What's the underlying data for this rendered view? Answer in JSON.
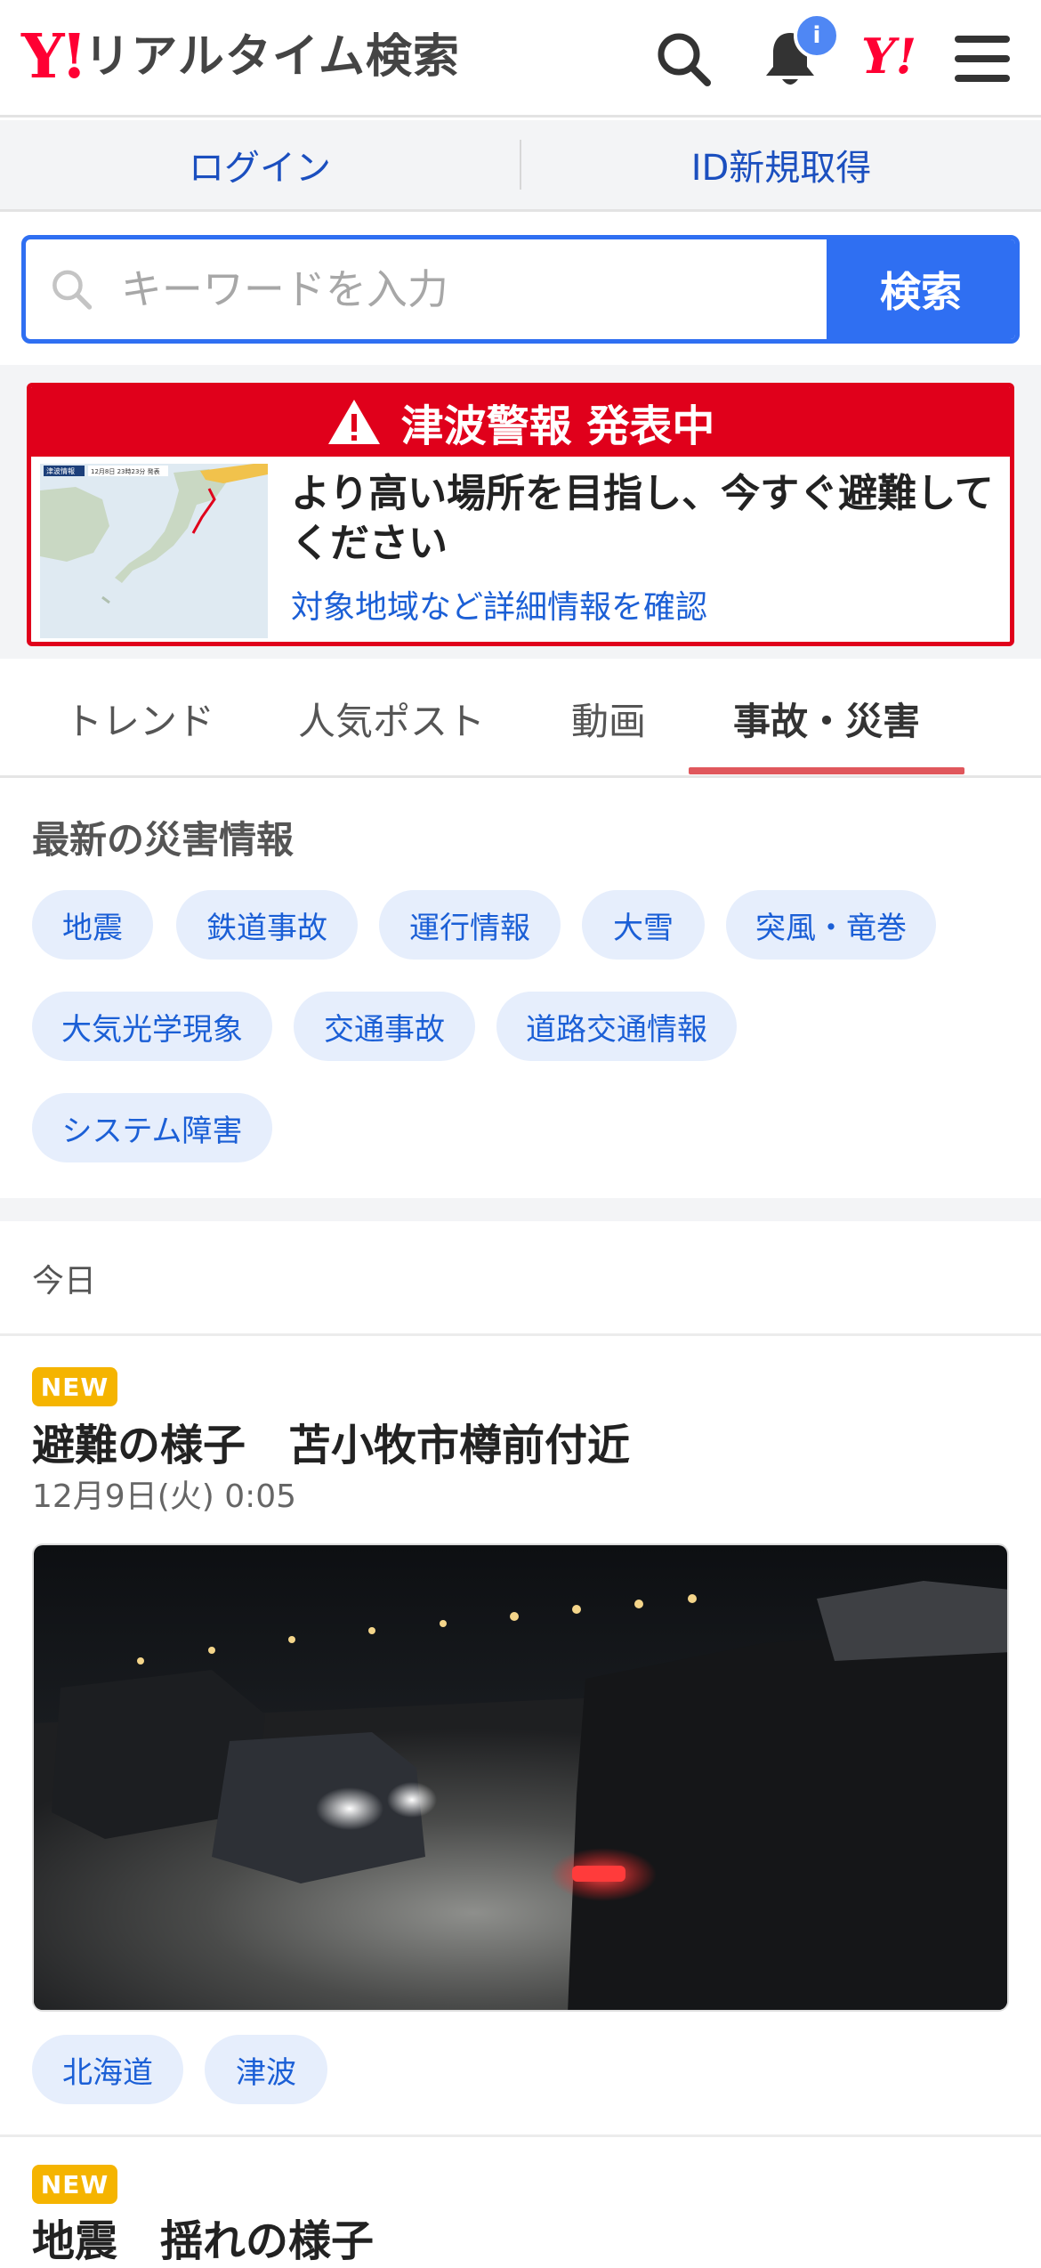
{
  "header": {
    "logo_mark": "Y!",
    "logo_text": "リアルタイム検索",
    "notification_badge": "i",
    "brand_small": "Y!"
  },
  "login_bar": {
    "login": "ログイン",
    "register": "ID新規取得"
  },
  "search": {
    "placeholder": "キーワードを入力",
    "button": "検索"
  },
  "alert": {
    "title": "津波警報 発表中",
    "message": "より高い場所を目指し、今すぐ避難してください",
    "link": "対象地域など詳細情報を確認",
    "map_caption": "津波情報",
    "map_time": "12月8日 23時23分 発表",
    "accent_color": "#e0001b"
  },
  "tabs": [
    {
      "label": "トレンド",
      "active": false
    },
    {
      "label": "人気ポスト",
      "active": false
    },
    {
      "label": "動画",
      "active": false
    },
    {
      "label": "事故・災害",
      "active": true
    }
  ],
  "disaster": {
    "title": "最新の災害情報",
    "chips": [
      "地震",
      "鉄道事故",
      "運行情報",
      "大雪",
      "突風・竜巻",
      "大気光学現象",
      "交通事故",
      "道路交通情報",
      "システム障害"
    ]
  },
  "feed": {
    "day_label": "今日",
    "posts": [
      {
        "badge": "NEW",
        "title": "避難の様子　苫小牧市樽前付近",
        "date": "12月9日(火) 0:05",
        "tags": [
          "北海道",
          "津波"
        ]
      },
      {
        "badge": "NEW",
        "title": "地震　揺れの様子"
      }
    ]
  }
}
